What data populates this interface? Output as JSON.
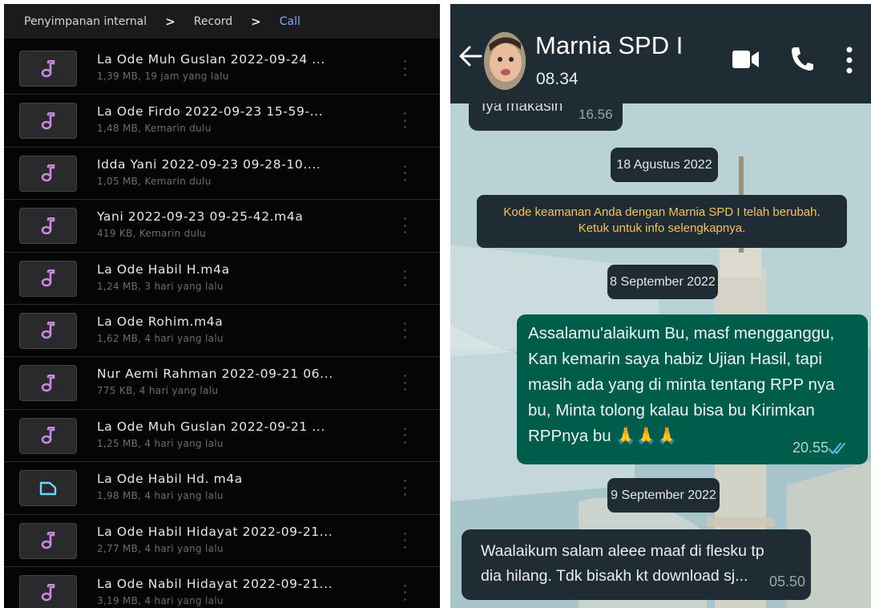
{
  "file_manager": {
    "breadcrumb": [
      "Penyimpanan internal",
      "Record",
      "Call"
    ],
    "breadcrumb_separator": ">",
    "files": [
      {
        "name": "La Ode Muh Guslan 2022-09-24 ...",
        "meta": "1,39 MB, 19 jam yang lalu",
        "icon": "music-note-icon"
      },
      {
        "name": "La Ode Firdo 2022-09-23 15-59-...",
        "meta": "1,48 MB, Kemarin dulu",
        "icon": "music-note-icon"
      },
      {
        "name": "Idda Yani 2022-09-23 09-28-10....",
        "meta": "1,05 MB, Kemarin dulu",
        "icon": "music-note-icon"
      },
      {
        "name": "Yani 2022-09-23 09-25-42.m4a",
        "meta": "419 KB, Kemarin dulu",
        "icon": "music-note-icon"
      },
      {
        "name": "La Ode Habil H.m4a",
        "meta": "1,24 MB, 3 hari yang lalu",
        "icon": "music-note-icon"
      },
      {
        "name": "La Ode Rohim.m4a",
        "meta": "1,62 MB, 4 hari yang lalu",
        "icon": "music-note-icon"
      },
      {
        "name": "Nur Aemi Rahman 2022-09-21 06...",
        "meta": "775 KB, 4 hari yang lalu",
        "icon": "music-note-icon"
      },
      {
        "name": "La Ode Muh Guslan 2022-09-21 ...",
        "meta": "1,25 MB, 4 hari yang lalu",
        "icon": "music-note-icon"
      },
      {
        "name": "La Ode Habil Hd. m4a",
        "meta": "1,98 MB, 4 hari yang lalu",
        "icon": "file-icon"
      },
      {
        "name": "La Ode Habil Hidayat 2022-09-21...",
        "meta": "2,77 MB, 4 hari yang lalu",
        "icon": "music-note-icon"
      },
      {
        "name": "La Ode Nabil Hidayat 2022-09-21...",
        "meta": "3,19 MB, 4 hari yang lalu",
        "icon": "music-note-icon"
      }
    ]
  },
  "chat": {
    "contact_name": "Marnia SPD I",
    "contact_status": "08.34",
    "messages": {
      "top_partial": {
        "text": "Iya makasih",
        "time": "16.56"
      },
      "date_1": "18 Agustus 2022",
      "security_notice": "Kode keamanan Anda dengan Marnia SPD I telah berubah. Ketuk untuk info selengkapnya.",
      "date_2": "8 September 2022",
      "outgoing": {
        "text": "Assalamu'alaikum Bu, masf mengganggu, Kan kemarin saya habiz Ujian Hasil, tapi masih ada yang di minta tentang RPP nya bu, Minta tolong kalau bisa bu Kirimkan RPPnya bu 🙏🙏🙏",
        "time": "20.55"
      },
      "date_3": "9 September 2022",
      "incoming": {
        "text": "Waalaikum salam aleee maaf di flesku tp dia hilang. Tdk bisakh kt download sj...",
        "time": "05.50"
      }
    }
  },
  "colors": {
    "file_manager_bg": "#050505",
    "breadcrumb_active": "#82a8ff",
    "music_icon": "#c98be0",
    "file_icon": "#6fd6f5",
    "chat_header_bg": "#1f2c33",
    "outgoing_bubble": "#005c4b",
    "notice_text": "#f1c55a",
    "read_ticks": "#53bdeb"
  }
}
